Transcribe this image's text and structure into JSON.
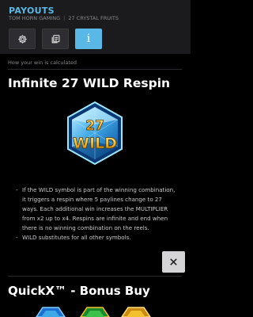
{
  "header": {
    "title": "PAYOUTS",
    "provider": "TOM HORN GAMING",
    "game": "27 CRYSTAL FRUITS",
    "tabs": [
      {
        "name": "settings",
        "icon": "gear-icon"
      },
      {
        "name": "history",
        "icon": "history-icon"
      },
      {
        "name": "info",
        "icon": "info-icon",
        "label": "i",
        "active": true
      }
    ]
  },
  "section_caption": "How your win is calculated",
  "wild_section": {
    "heading": "Infinite 27 WILD Respin",
    "symbol": {
      "top": "27",
      "bottom": "WILD",
      "icon": "wild-crystal-symbol"
    },
    "bullets": [
      "If the WILD symbol is part of the winning combination, it triggers a respin where 5 paylines change to 27 ways. Each additional win increases the MULTIPLIER from x2 up to x4. Respins are infinite and end when there is no winning combination on the reels.",
      "WILD substitutes for all other symbols."
    ]
  },
  "bonus_section": {
    "heading": "QuickX™ - Bonus Buy"
  },
  "close_button": {
    "icon": "close-icon"
  },
  "colors": {
    "accent": "#5ab8e6",
    "background": "#000000",
    "header": "#1b1b1d"
  }
}
